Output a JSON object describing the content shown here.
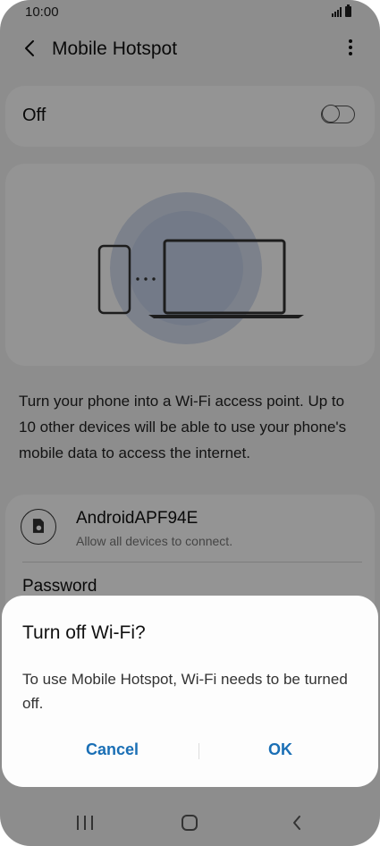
{
  "status_bar": {
    "time": "10:00"
  },
  "header": {
    "title": "Mobile Hotspot"
  },
  "hotspot_toggle": {
    "label": "Off",
    "state": "off"
  },
  "description": "Turn your phone into a Wi-Fi access point. Up to 10 other devices will be able to use your phone's mobile data to access the internet.",
  "network": {
    "name": "AndroidAPF94E",
    "subtitle": "Allow all devices to connect.",
    "password_label": "Password"
  },
  "dialog": {
    "title": "Turn off Wi-Fi?",
    "message": "To use Mobile Hotspot, Wi-Fi needs to be turned off.",
    "cancel_label": "Cancel",
    "ok_label": "OK"
  },
  "colors": {
    "accent": "#1a6fb5",
    "illustration_ring": "#c9d6ea",
    "background": "#f3f3f3"
  },
  "icons": {
    "back": "chevron-left-icon",
    "more": "more-vertical-icon",
    "hotspot": "hotspot-icon",
    "nav_recent": "recent-apps-icon",
    "nav_home": "home-icon",
    "nav_back": "back-icon"
  }
}
